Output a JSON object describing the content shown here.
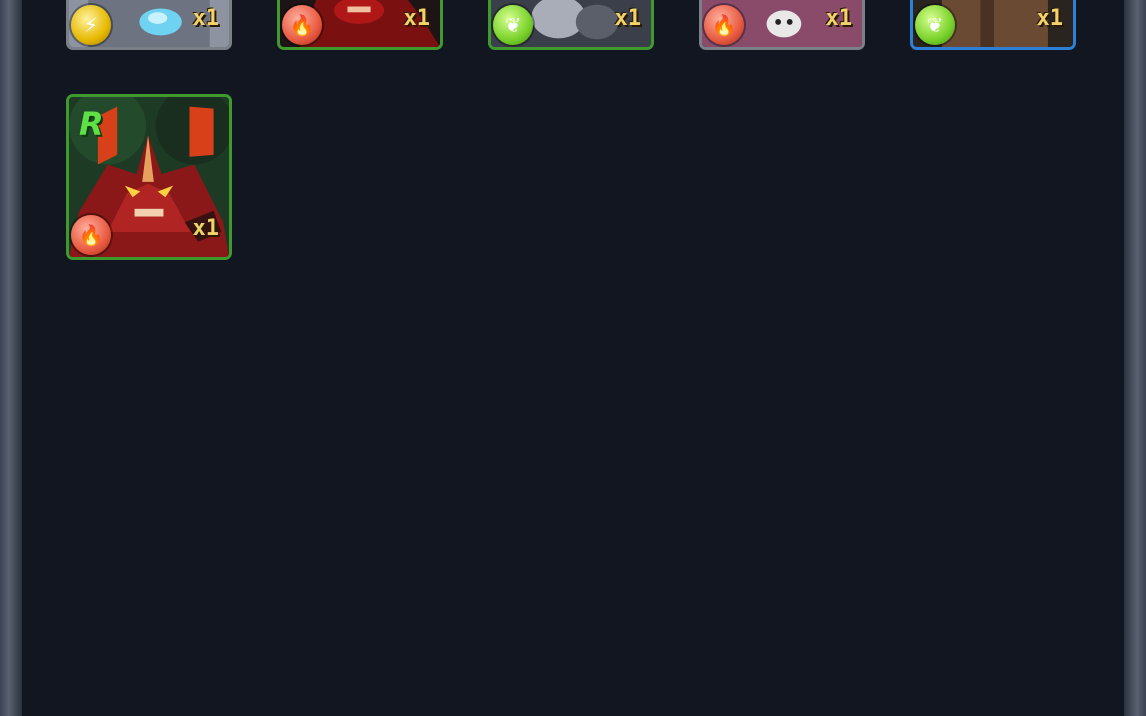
{
  "inventory": {
    "row1": [
      {
        "id": "card-1",
        "element": "lightning",
        "element_icon": "lightning-icon",
        "quantity": "x1",
        "border": "grey"
      },
      {
        "id": "card-2",
        "element": "fire",
        "element_icon": "fire-icon",
        "quantity": "x1",
        "border": "green"
      },
      {
        "id": "card-3",
        "element": "earth",
        "element_icon": "leaf-icon",
        "quantity": "x1",
        "border": "green"
      },
      {
        "id": "card-4",
        "element": "fire",
        "element_icon": "fire-icon",
        "quantity": "x1",
        "border": "grey"
      },
      {
        "id": "card-5",
        "element": "earth",
        "element_icon": "leaf-icon",
        "quantity": "x1",
        "border": "blue"
      }
    ],
    "row2": [
      {
        "id": "card-6",
        "element": "fire",
        "element_icon": "fire-icon",
        "quantity": "x1",
        "rank": "R",
        "border": "green"
      }
    ]
  },
  "colors": {
    "background": "#121620",
    "quantity_text": "#f2d26a",
    "rank_text": "#5fe046",
    "border_green": "#3e9a2e",
    "border_grey": "#7a7f88",
    "border_blue": "#2e7fd6"
  }
}
